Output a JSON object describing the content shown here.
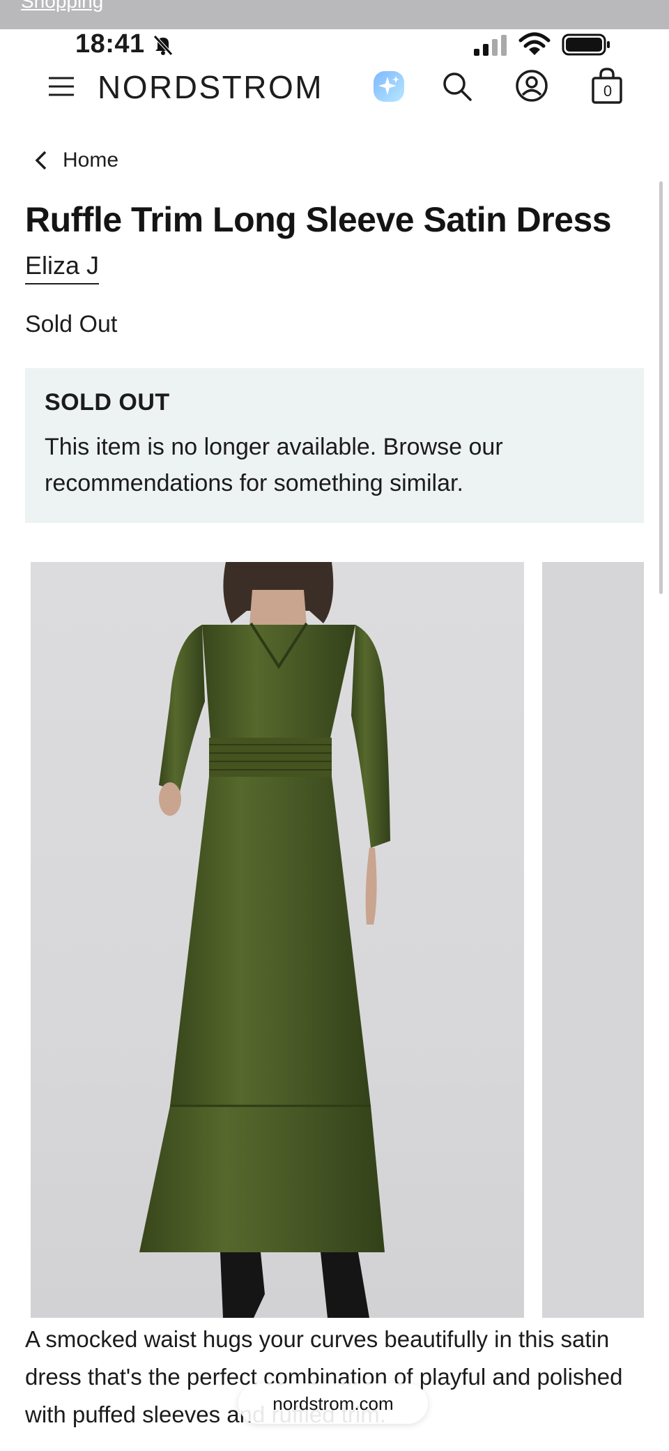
{
  "browser": {
    "previous_page_link": "Shopping",
    "url": "nordstrom.com"
  },
  "status_bar": {
    "time": "18:41"
  },
  "header": {
    "brand": "NORDSTROM",
    "bag_count": "0"
  },
  "breadcrumb": {
    "label": "Home"
  },
  "product": {
    "title": "Ruffle Trim Long Sleeve Satin Dress",
    "brand": "Eliza J",
    "availability": "Sold Out",
    "notice": {
      "heading": "SOLD OUT",
      "body": "This item is no longer available. Browse our recommendations for something similar."
    },
    "description": "A smocked waist hugs your curves beautifully in this satin dress that's the perfect combination of playful and polished with puffed sleeves and ruffled trim."
  },
  "colors": {
    "dress_green": "#4a5a26",
    "notice_background": "#edf2f2",
    "ai_icon_gradient": [
      "#7fb8ff",
      "#b7e7ff"
    ]
  }
}
